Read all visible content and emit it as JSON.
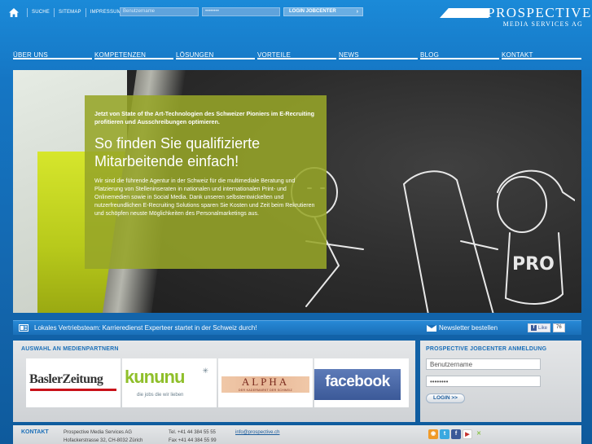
{
  "toplinks": [
    "SUCHE",
    "SITEMAP",
    "IMPRESSUM"
  ],
  "login": {
    "username_placeholder": "Benutzername",
    "password_placeholder": "••••••••",
    "button_label": "LOGIN JOBCENTER",
    "button_chevron": "›"
  },
  "logo": {
    "line1": "PROSPECTIVE",
    "line2": "MEDIA SERVICES AG"
  },
  "nav": [
    "ÜBER UNS",
    "KOMPETENZEN",
    "LÖSUNGEN",
    "VORTEILE",
    "NEWS",
    "BLOG",
    "KONTAKT"
  ],
  "hero": {
    "kicker": "Jetzt von State of the Art-Technologien des Schweizer Pioniers im E-Recruiting profitieren und Ausschreibungen optimieren.",
    "headline": "So finden Sie qualifizierte Mitarbeitende einfach!",
    "body": "Wir sind die führende Agentur in der Schweiz für die multimediale Beratung und Platzierung von Stelleninseraten in nationalen und internationalen Print- und Onlinemedien sowie in Social Media. Dank unseren selbstentwickelten und nutzerfreundlichen E-Recruiting Solutions sparen Sie Kosten und Zeit beim Rekrutieren und schöpfen neuste Möglichkeiten des Personalmarketings aus.",
    "drawing_text": "PRO"
  },
  "ticker": {
    "news": "Lokales Vertriebsteam: Karrieredienst Experteer startet in der Schweiz durch!",
    "newsletter": "Newsletter bestellen",
    "like_label": "Like",
    "like_count": "76"
  },
  "partners": {
    "title": "AUSWAHL AN MEDIENPARTNERN",
    "baslerzeitung": "BaslerZeitung",
    "kununu": "kununu",
    "kununu_tagline": "die jobs die wir lieben",
    "alpha": "ALPHA",
    "alpha_tagline": "DER KADERMARKT DER SCHWEIZ",
    "facebook": "facebook"
  },
  "jobcenter": {
    "title": "PROSPECTIVE JOBCENTER ANMELDUNG",
    "username_value": "Benutzername",
    "password_value": "••••••••",
    "button_label": "LOGIN >>"
  },
  "footer": {
    "title": "KONTAKT",
    "company": "Prospective Media Services AG",
    "address": "Hofackerstrasse 32, CH-8032 Zürich",
    "tel": "Tel. +41 44 384 55 55",
    "fax": "Fax +41 44 384 55 99",
    "email": "info@prospective.ch",
    "social": [
      "rss-icon",
      "twitter-icon",
      "facebook-icon",
      "youtube-icon",
      "xing-icon"
    ]
  },
  "colors": {
    "brand_blue": "#1b6fb8",
    "hero_box": "#96a528",
    "facebook": "#3b5998"
  }
}
